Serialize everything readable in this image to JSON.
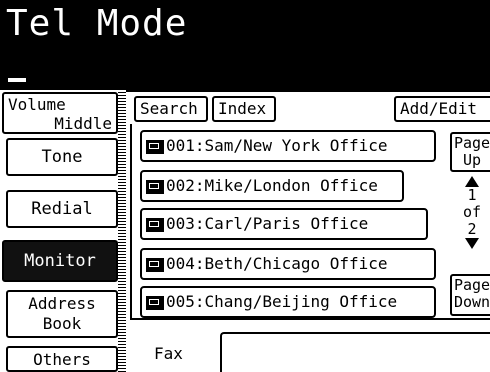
{
  "header": {
    "title": "Tel Mode"
  },
  "left": {
    "volume_line1": "Volume",
    "volume_line2": "Middle",
    "tone": "Tone",
    "redial": "Redial",
    "monitor": "Monitor",
    "address_line1": "Address",
    "address_line2": "Book",
    "others": "Others"
  },
  "toolbar": {
    "search": "Search",
    "index": "Index",
    "add_edit": "Add/Edit"
  },
  "entries": [
    {
      "label": "001:Sam/New York Office"
    },
    {
      "label": "002:Mike/London Office"
    },
    {
      "label": "003:Carl/Paris Office"
    },
    {
      "label": "004:Beth/Chicago Office"
    },
    {
      "label": "005:Chang/Beijing Office"
    }
  ],
  "paging": {
    "up_line1": "Page",
    "up_line2": "Up",
    "down_line1": "Page",
    "down_line2": "Down",
    "current": "1",
    "of": "of",
    "total": "2"
  },
  "bottom": {
    "fax_label": "Fax"
  }
}
